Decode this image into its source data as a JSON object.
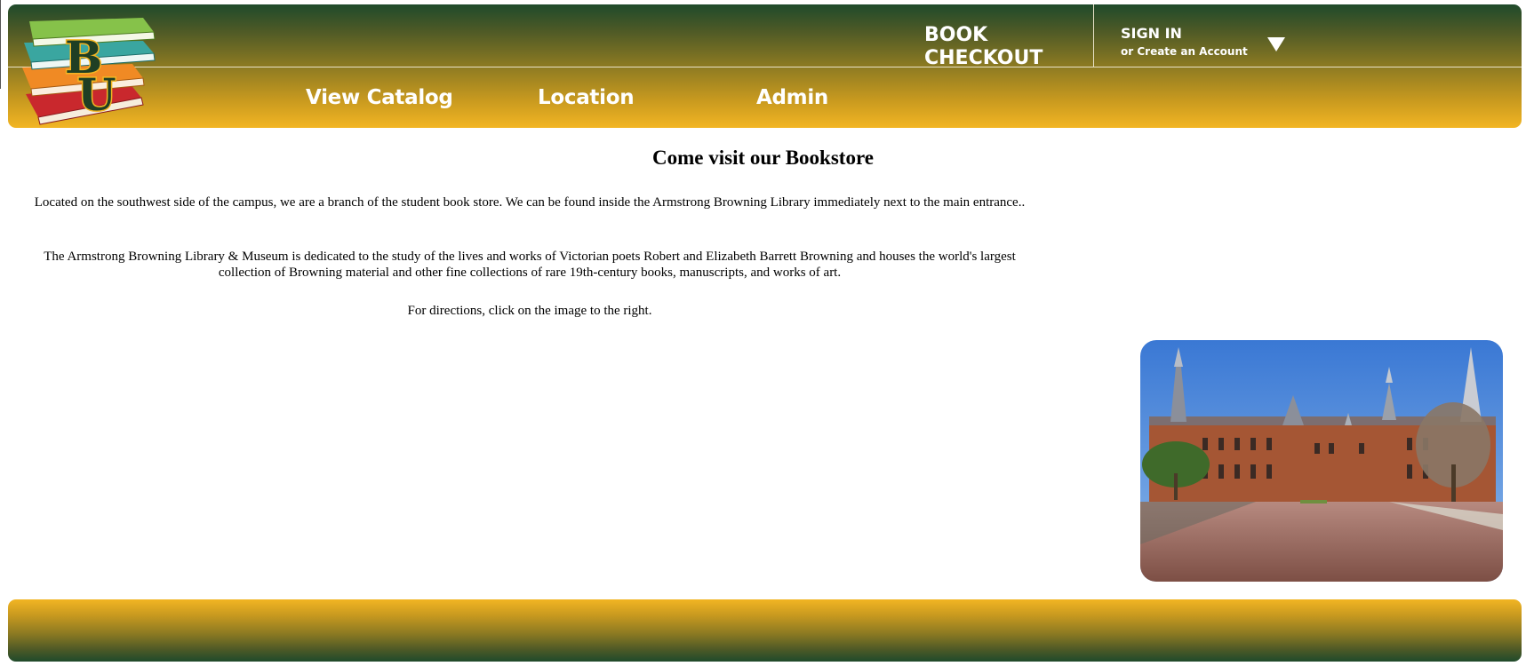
{
  "header": {
    "brand_title_line1": "BOOK",
    "brand_title_line2": "CHECKOUT",
    "signin_label": "SIGN IN",
    "create_account_label": "or Create an Account",
    "logo_letters": "BU",
    "nav": [
      {
        "label": "View Catalog"
      },
      {
        "label": "Location"
      },
      {
        "label": "Admin"
      }
    ]
  },
  "main": {
    "title": "Come visit our Bookstore",
    "paragraphs": [
      "Located on the southwest side of the campus, we are a branch of the student book store. We can be found inside the Armstrong Browning Library immediately next to the main entrance..",
      "The Armstrong Browning Library & Museum is dedicated to the study of the lives and works of Victorian poets Robert and Elizabeth Barrett Browning and houses the world's largest collection of Browning material and other fine collections of rare 19th-century books, manuscripts, and works of art.",
      "For directions, click on the image to the right."
    ]
  },
  "colors": {
    "brand_green": "#1f4a2b",
    "brand_gold": "#f2b523"
  },
  "icons": {
    "logo": "stacked-books-logo",
    "dropdown": "triangle-down-icon",
    "photo": "library-building-photo"
  }
}
